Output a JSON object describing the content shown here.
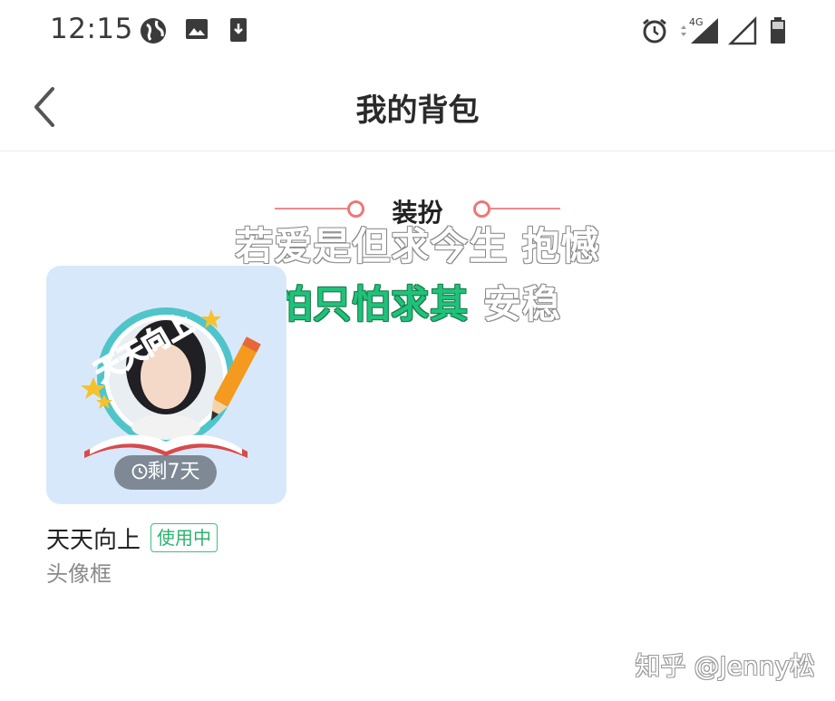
{
  "status_bar": {
    "time": "12:15",
    "network_label": "4G"
  },
  "header": {
    "title": "我的背包"
  },
  "section": {
    "title": "装扮"
  },
  "overlay": {
    "line1": "若爱是但求今生 抱憾",
    "line2_green": "怕只怕求其",
    "line2_white": "安稳"
  },
  "item": {
    "frame_text": "天天向上",
    "remaining": "剩7天",
    "name": "天天向上",
    "status": "使用中",
    "type": "头像框"
  },
  "watermark": "知乎 @Jenny松",
  "colors": {
    "accent_green": "#2bb36d",
    "section_red": "#f07676",
    "card_bg": "#d8e8fb"
  }
}
